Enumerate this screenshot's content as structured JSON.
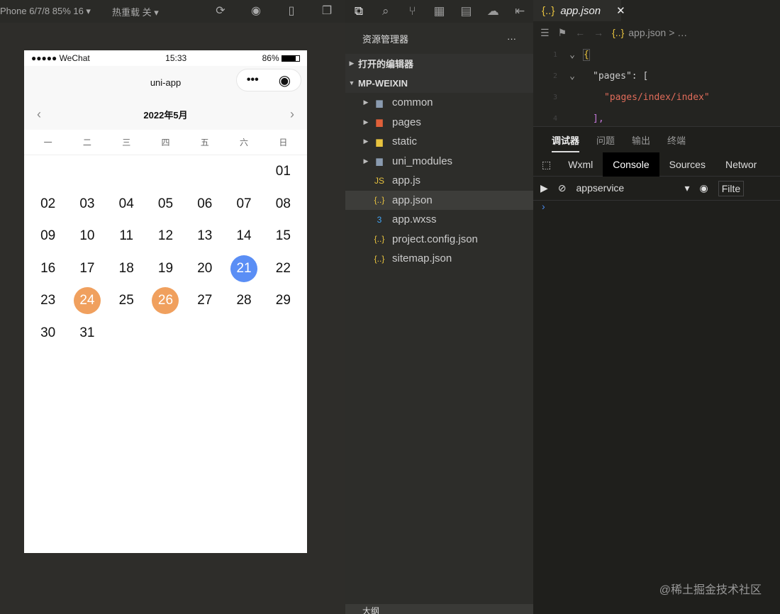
{
  "simulator": {
    "device": "Phone 6/7/8 85% 16 ▾",
    "hot_reload": "热重载 关 ▾"
  },
  "phone": {
    "carrier": "●●●●● WeChat",
    "time": "15:33",
    "battery": "86%",
    "title": "uni-app",
    "month": "2022年5月",
    "weekdays": [
      "一",
      "二",
      "三",
      "四",
      "五",
      "六",
      "日"
    ],
    "days": [
      "",
      "",
      "",
      "",
      "",
      "",
      "01",
      "02",
      "03",
      "04",
      "05",
      "06",
      "07",
      "08",
      "09",
      "10",
      "11",
      "12",
      "13",
      "14",
      "15",
      "16",
      "17",
      "18",
      "19",
      "20",
      "21",
      "22",
      "23",
      "24",
      "25",
      "26",
      "27",
      "28",
      "29",
      "30",
      "31"
    ],
    "selected_blue": [
      "21"
    ],
    "selected_orange": [
      "24",
      "26"
    ],
    "colors": {
      "blue": "#5a8ef5",
      "orange": "#f0a05e"
    }
  },
  "explorer": {
    "title": "资源管理器",
    "more": "···",
    "open_editors": "打开的编辑器",
    "project": "MP-WEIXIN",
    "items": [
      {
        "name": "common",
        "type": "folder"
      },
      {
        "name": "pages",
        "type": "folder"
      },
      {
        "name": "static",
        "type": "folder"
      },
      {
        "name": "uni_modules",
        "type": "folder"
      },
      {
        "name": "app.js",
        "type": "js"
      },
      {
        "name": "app.json",
        "type": "json"
      },
      {
        "name": "app.wxss",
        "type": "css"
      },
      {
        "name": "project.config.json",
        "type": "json"
      },
      {
        "name": "sitemap.json",
        "type": "json"
      }
    ],
    "outline": "大纲"
  },
  "editor": {
    "tab": "app.json",
    "close": "✕",
    "breadcrumb": "app.json",
    "breadcrumb_more": "> …",
    "lines": [
      {
        "n": "1",
        "t": "{"
      },
      {
        "n": "2",
        "t": "\"pages\": ["
      },
      {
        "n": "3",
        "t": "\"pages/index/index\""
      },
      {
        "n": "4",
        "t": "],"
      }
    ]
  },
  "panel": {
    "tabs": [
      "调试器",
      "问题",
      "输出",
      "终端"
    ],
    "devtabs": [
      "Wxml",
      "Console",
      "Sources",
      "Networ"
    ],
    "context": "appservice",
    "filter": "Filte",
    "prompt": "›"
  },
  "watermark": "@稀土掘金技术社区"
}
